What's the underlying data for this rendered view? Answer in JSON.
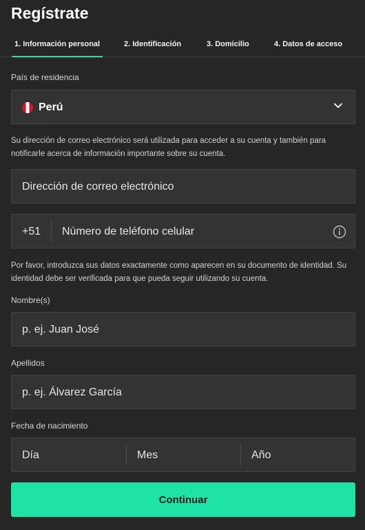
{
  "header": {
    "title": "Regístrate"
  },
  "tabs": [
    {
      "label": "1. Información personal",
      "active": true
    },
    {
      "label": "2. Identificación",
      "active": false
    },
    {
      "label": "3. Domicilio",
      "active": false
    },
    {
      "label": "4. Datos de acceso",
      "active": false
    }
  ],
  "country": {
    "label": "País de residencia",
    "value": "Perú",
    "flag_icon": "peru-flag-icon",
    "dropdown_icon": "chevron-down-icon"
  },
  "email": {
    "info": "Su dirección de correo electrónico será utilizada para acceder a su cuenta y también para notificarle acerca de información importante sobre su cuenta.",
    "placeholder": "Dirección de correo electrónico"
  },
  "phone": {
    "prefix": "+51",
    "placeholder": "Número de teléfono celular",
    "info_icon": "info-icon"
  },
  "identity_info": "Por favor, introduzca sus datos exactamente como aparecen en su documento de identidad. Su identidad debe ser verificada para que pueda seguir utilizando su cuenta.",
  "first_name": {
    "label": "Nombre(s)",
    "placeholder": "p. ej. Juan José"
  },
  "last_name": {
    "label": "Apellidos",
    "placeholder": "p. ej. Álvarez García"
  },
  "birthdate": {
    "label": "Fecha de nacimiento",
    "day": "Día",
    "month": "Mes",
    "year": "Año"
  },
  "continue_button": "Continuar",
  "colors": {
    "accent": "#1fe3a6",
    "background": "#262626",
    "field": "#333333"
  }
}
